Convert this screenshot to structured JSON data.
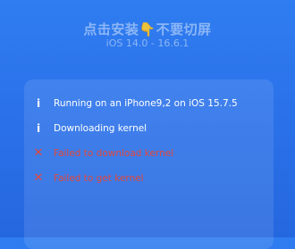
{
  "header": {
    "title_prefix": "点击安装",
    "title_suffix": "不要切屏",
    "hand_glyph": "👇",
    "subtitle": "iOS 14.0 - 16.6.1"
  },
  "log": {
    "entries": [
      {
        "type": "info",
        "icon": "info-icon",
        "glyph": "i",
        "text": "Running on an iPhone9,2 on iOS 15.7.5"
      },
      {
        "type": "info",
        "icon": "info-icon",
        "glyph": "i",
        "text": "Downloading kernel"
      },
      {
        "type": "error",
        "icon": "close-x-icon",
        "glyph": "✕",
        "text": "Failed to download kernel"
      },
      {
        "type": "error",
        "icon": "close-x-icon",
        "glyph": "✕",
        "text": "Failed to get kernel"
      }
    ]
  },
  "colors": {
    "background": "#2b72ea",
    "error": "#e0473d",
    "info": "#ffffff"
  }
}
